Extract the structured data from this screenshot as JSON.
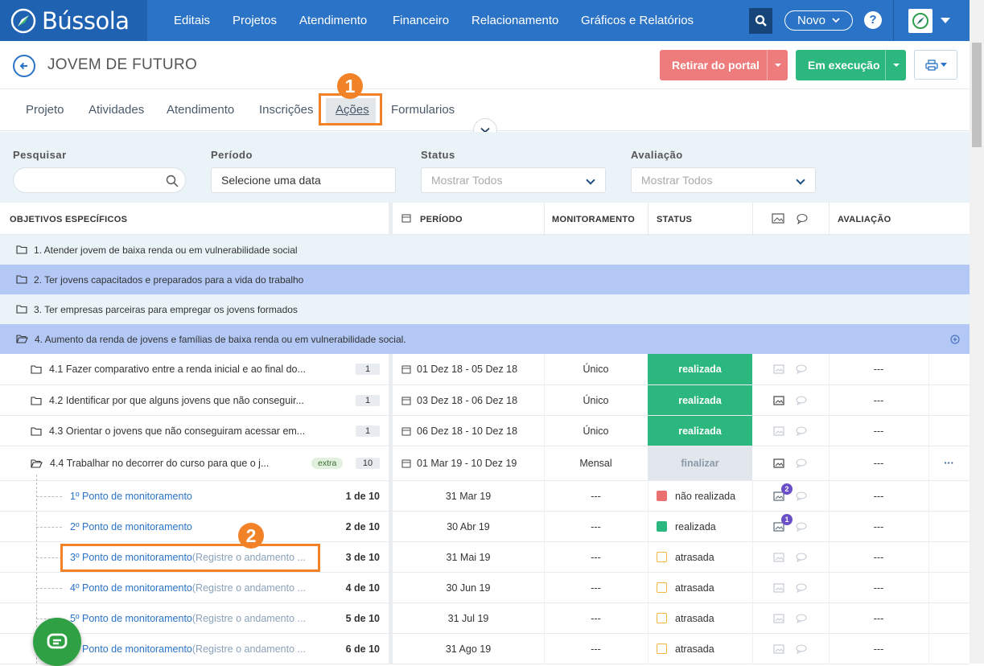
{
  "nav": {
    "logo": "Bússola",
    "items": [
      "Editais",
      "Projetos",
      "Atendimento",
      "Financeiro",
      "Relacionamento",
      "Gráficos e Relatórios"
    ],
    "new_label": "Novo",
    "help": "?"
  },
  "header": {
    "title": "JOVEM DE FUTURO",
    "btn_remove": "Retirar do portal",
    "btn_status": "Em execução"
  },
  "tabs": [
    "Projeto",
    "Atividades",
    "Atendimento",
    "Inscrições",
    "Ações",
    "Formularios"
  ],
  "callouts": [
    "1",
    "2"
  ],
  "filters": {
    "search_label": "Pesquisar",
    "period_label": "Período",
    "period_value": "Selecione uma data",
    "status_label": "Status",
    "status_value": "Mostrar Todos",
    "eval_label": "Avaliação",
    "eval_value": "Mostrar Todos"
  },
  "table": {
    "headers": [
      "OBJETIVOS ESPECÍFICOS",
      "PERÍODO",
      "MONITORAMENTO",
      "STATUS",
      "AVALIAÇÃO"
    ],
    "objectives": [
      "1. Atender jovem de baixa renda ou em vulnerabilidade social",
      "2. Ter jovens capacitados e preparados para a vida do trabalho",
      "3. Ter empresas parceiras para empregar os jovens formados",
      "4. Aumento da renda de jovens e famílias de baixa renda ou em vulnerabilidade social."
    ],
    "actions": [
      {
        "name": "4.1 Fazer comparativo entre a renda inicial e ao final do...",
        "count": "1",
        "period": "01 Dez 18 - 05 Dez 18",
        "monitor": "Único",
        "status": "realizada",
        "eval": "---"
      },
      {
        "name": "4.2 Identificar por que alguns jovens que não conseguir...",
        "count": "1",
        "period": "03 Dez 18 - 06 Dez 18",
        "monitor": "Único",
        "status": "realizada",
        "eval": "---"
      },
      {
        "name": "4.3 Orientar o jovens que não conseguiram acessar em...",
        "count": "1",
        "period": "06 Dez 18 - 10 Dez 18",
        "monitor": "Único",
        "status": "realizada",
        "eval": "---"
      },
      {
        "name": "4.4 Trabalhar no decorrer do curso para que o j...",
        "tag": "extra",
        "count": "10",
        "period": "01 Mar 19 - 10 Dez 19",
        "monitor": "Mensal",
        "status": "finalizar",
        "eval": "---",
        "more": "···"
      }
    ],
    "points": [
      {
        "name": "1º Ponto de monitoramento",
        "hint": "",
        "of": "1 de 10",
        "date": "31 Mar 19",
        "monitor": "---",
        "status": "não realizada",
        "color": "#ea6f6f",
        "badge": "2",
        "eval": "---"
      },
      {
        "name": "2º Ponto de monitoramento",
        "hint": "",
        "of": "2 de 10",
        "date": "30 Abr 19",
        "monitor": "---",
        "status": "realizada",
        "color": "#2cb77e",
        "badge": "1",
        "eval": "---"
      },
      {
        "name": "3º Ponto de monitoramento",
        "hint": " (Registre o andamento ...",
        "of": "3 de 10",
        "date": "31 Mai 19",
        "monitor": "---",
        "status": "atrasada",
        "color": "#f4b53f",
        "badge": "",
        "eval": "---"
      },
      {
        "name": "4º Ponto de monitoramento",
        "hint": " (Registre o andamento ...",
        "of": "4 de 10",
        "date": "30 Jun 19",
        "monitor": "---",
        "status": "atrasada",
        "color": "#f4b53f",
        "badge": "",
        "eval": "---"
      },
      {
        "name": "5º Ponto de monitoramento",
        "hint": " (Registre o andamento ...",
        "of": "5 de 10",
        "date": "31 Jul 19",
        "monitor": "---",
        "status": "atrasada",
        "color": "#f4b53f",
        "badge": "",
        "eval": "---"
      },
      {
        "name": "6º Ponto de monitoramento",
        "hint": " (Registre o andamento ...",
        "of": "6 de 10",
        "date": "31 Ago 19",
        "monitor": "---",
        "status": "atrasada",
        "color": "#f4b53f",
        "badge": "",
        "eval": "---"
      }
    ]
  }
}
